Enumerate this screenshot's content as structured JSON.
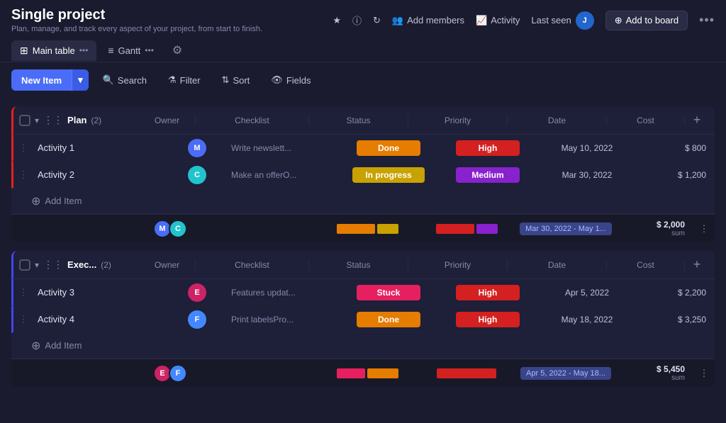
{
  "project": {
    "title": "Single project",
    "subtitle": "Plan, manage, and track every aspect of your project, from start to finish."
  },
  "header": {
    "star_icon": "★",
    "info_icon": "ⓘ",
    "refresh_icon": "↻",
    "add_members_label": "Add members",
    "activity_label": "Activity",
    "last_seen_label": "Last seen",
    "avatar_letter": "J",
    "add_to_board_label": "Add to board",
    "more_icon": "•••"
  },
  "tabs": [
    {
      "id": "main-table",
      "label": "Main table",
      "active": true
    },
    {
      "id": "gantt",
      "label": "Gantt",
      "active": false
    }
  ],
  "toolbar": {
    "new_item_label": "New Item",
    "search_label": "Search",
    "filter_label": "Filter",
    "sort_label": "Sort",
    "fields_label": "Fields"
  },
  "groups": [
    {
      "id": "plan",
      "name": "Plan",
      "short": "Exec...",
      "count": 2,
      "color": "#e62020",
      "columns": [
        "Owner",
        "Checklist",
        "Status",
        "Priority",
        "Date",
        "Cost"
      ],
      "rows": [
        {
          "name": "Activity 1",
          "owner": "M",
          "owner_color": "#4a6cf7",
          "checklist": "Write newslett...",
          "status": "Done",
          "status_class": "badge-done",
          "priority": "High",
          "priority_class": "priority-high",
          "date": "May 10, 2022",
          "cost": "$ 800"
        },
        {
          "name": "Activity 2",
          "owner": "C",
          "owner_color": "#22c4cc",
          "checklist": "Make an offerO...",
          "status": "In progress",
          "status_class": "badge-inprogress",
          "priority": "Medium",
          "priority_class": "priority-medium",
          "date": "Mar 30, 2022",
          "cost": "$ 1,200"
        }
      ],
      "summary": {
        "avatars": [
          "M",
          "C"
        ],
        "avatar_colors": [
          "#4a6cf7",
          "#22c4cc"
        ],
        "date_range": "Mar 30, 2022 - May 1...",
        "cost_total": "$ 2,000",
        "cost_label": "sum"
      }
    },
    {
      "id": "execute",
      "name": "Exec...",
      "count": 2,
      "color": "#4444ee",
      "columns": [
        "Owner",
        "Checklist",
        "Status",
        "Priority",
        "Date",
        "Cost"
      ],
      "rows": [
        {
          "name": "Activity 3",
          "owner": "E",
          "owner_color": "#cc2266",
          "checklist": "Features updat...",
          "status": "Stuck",
          "status_class": "badge-stuck",
          "priority": "High",
          "priority_class": "priority-high",
          "date": "Apr 5, 2022",
          "cost": "$ 2,200"
        },
        {
          "name": "Activity 4",
          "owner": "F",
          "owner_color": "#4488ff",
          "checklist": "Print labelsPro...",
          "status": "Done",
          "status_class": "badge-done",
          "priority": "High",
          "priority_class": "priority-high",
          "date": "May 18, 2022",
          "cost": "$ 3,250"
        }
      ],
      "summary": {
        "avatars": [
          "E",
          "F"
        ],
        "avatar_colors": [
          "#cc2266",
          "#4488ff"
        ],
        "date_range": "Apr 5, 2022 - May 18...",
        "cost_total": "$ 5,450",
        "cost_label": "sum"
      }
    }
  ]
}
